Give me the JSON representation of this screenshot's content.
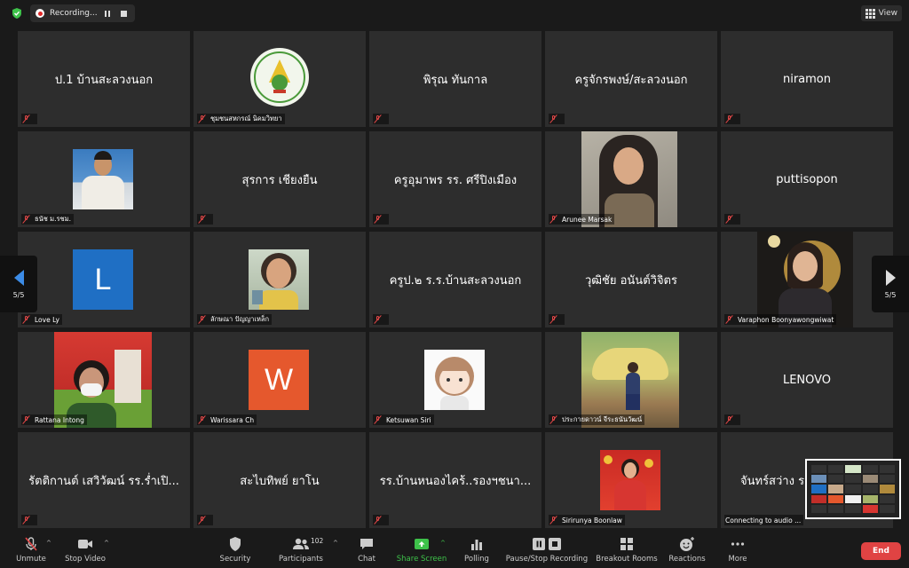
{
  "topbar": {
    "recording_label": "Recording...",
    "view_label": "View"
  },
  "tiles": {
    "t1": {
      "center": "ป.1 บ้านสะลวงนอก"
    },
    "t2": {
      "name": "ชุมชนสหกรณ์ นิคมวิทยา"
    },
    "t3": {
      "center": "พิรุณ ทันกาล"
    },
    "t4": {
      "center": "ครูจักรพงษ์/สะลวงนอก"
    },
    "t5": {
      "center": "niramon"
    },
    "t6": {
      "name": "ธนัช ม.รชม."
    },
    "t7": {
      "center": "สุรการ เชียงยืน"
    },
    "t8": {
      "center": "ครูอุมาพร รร. ศรีปิงเมือง"
    },
    "t9": {
      "name": "Arunee Marsak"
    },
    "t10": {
      "center": "puttisopon"
    },
    "t11": {
      "name": "Love Ly",
      "avatar_letter": "L"
    },
    "t12": {
      "name": "ลักษณา ปัญญาเหล็ก"
    },
    "t13": {
      "center": "ครูป.๒ ร.ร.บ้านสะลวงนอก"
    },
    "t14": {
      "center": "วุฒิชัย อนันต์วิจิตร"
    },
    "t15": {
      "name": "Varaphon Boonyawongwiwat"
    },
    "t16": {
      "name": "Rattana Intong"
    },
    "t17": {
      "name": "Warissara Ch",
      "avatar_letter": "W"
    },
    "t18": {
      "name": "Ketsuwan Siri"
    },
    "t19": {
      "name": "ประกายดาวน์ จีระธนันวัฒน์"
    },
    "t20": {
      "center": "LENOVO"
    },
    "t21": {
      "center": "รัตติกานต์ เสวิวัฒน์ รร.ร่ำเปิ..."
    },
    "t22": {
      "center": "สะไบทิพย์ ยาโน"
    },
    "t23": {
      "center": "รร.บ้านหนองไคร้..รองฯชนา..."
    },
    "t24": {
      "name": "Sirirunya Boonlaw"
    },
    "t25": {
      "center": "จันทร์สว่าง ร",
      "name": "Connecting to audio ..."
    }
  },
  "pager": {
    "left_text": "5/5",
    "right_text": "5/5"
  },
  "toolbar": {
    "unmute": "Unmute",
    "stop_video": "Stop Video",
    "security": "Security",
    "participants": "Participants",
    "participant_count": "102",
    "chat": "Chat",
    "share_screen": "Share Screen",
    "polling": "Polling",
    "pause_stop_recording": "Pause/Stop Recording",
    "breakout_rooms": "Breakout Rooms",
    "reactions": "Reactions",
    "more": "More",
    "end": "End"
  },
  "colors": {
    "share_green": "#3ec24a",
    "end_red": "#e04343",
    "mute_red": "#e54848",
    "avatar_blue": "#1f6fc4",
    "avatar_orange": "#e5582d"
  }
}
